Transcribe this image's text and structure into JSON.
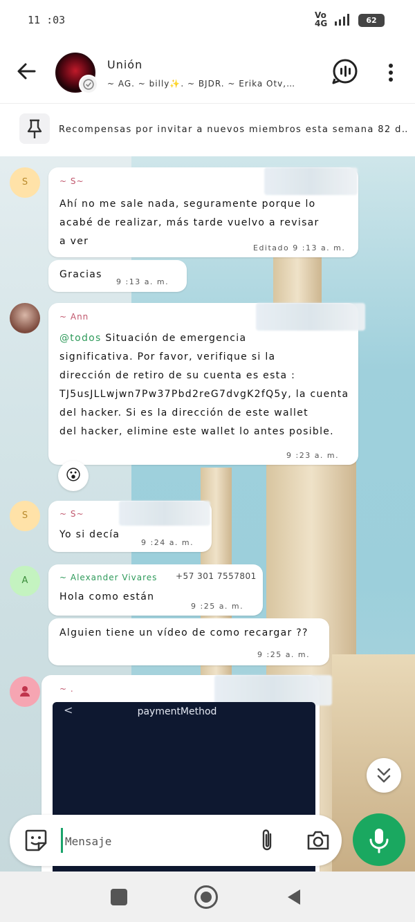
{
  "status_bar": {
    "time": "11 :03",
    "network": "Vo 4G",
    "signal_label": "4G",
    "battery": "62"
  },
  "header": {
    "title": "Unión",
    "members": "~ AG. ~   billy✨. ~   BJDR. ~   Erika Otv,…",
    "back_icon": "arrow-left-icon",
    "voice_icon": "voice-chat-icon",
    "menu_icon": "more-vert-icon"
  },
  "pinned": {
    "icon": "pin-icon",
    "text": "Recompensas por invitar a nuevos miembros esta semana 82 d…"
  },
  "messages": [
    {
      "sender": "~ S~",
      "avatar_letter": "S",
      "lines": [
        "Ahí no me sale nada, seguramente porque lo",
        "acabé de realizar, más tarde vuelvo a revisar",
        "a ver"
      ],
      "time": "Editado 9 :13 a. m."
    },
    {
      "text": "Gracias",
      "time": "9 :13 a. m."
    },
    {
      "sender": "~ Ann",
      "mention": "@todos",
      "lines": [
        "Situación de emergencia",
        "significativa. Por favor, verifique si la",
        "dirección de retiro de su cuenta es esta :",
        "TJ5usJLLwjwn7Pw37Pbd2reG7dvgK2fQ5y, la cuenta",
        "del hacker. Si es la dirección de este wallet",
        "del hacker, elimine este wallet lo antes posible."
      ],
      "time": "9 :23 a. m.",
      "reaction": "😮"
    },
    {
      "sender": "~ S~",
      "avatar_letter": "S",
      "text": "Yo si decía",
      "time": "9 :24 a. m."
    },
    {
      "sender": "~ Alexander Vivares",
      "phone": "+57 301 7557801",
      "avatar_letter": "A",
      "text": "Hola como están",
      "time": "9 :25 a. m."
    },
    {
      "text": "Alguien tiene un vídeo de como recargar ??",
      "time": "9 :25 a. m."
    },
    {
      "sender": "~ .",
      "image_title": "paymentMethod",
      "image_back": "<"
    }
  ],
  "input": {
    "placeholder": "Mensaje",
    "sticker_icon": "sticker-icon",
    "attach_icon": "paperclip-icon",
    "camera_icon": "camera-icon",
    "mic_icon": "mic-icon"
  },
  "colors": {
    "accent_green": "#1aa860",
    "sender_pink": "#c0566c",
    "sender_green": "#2e9a5a"
  }
}
